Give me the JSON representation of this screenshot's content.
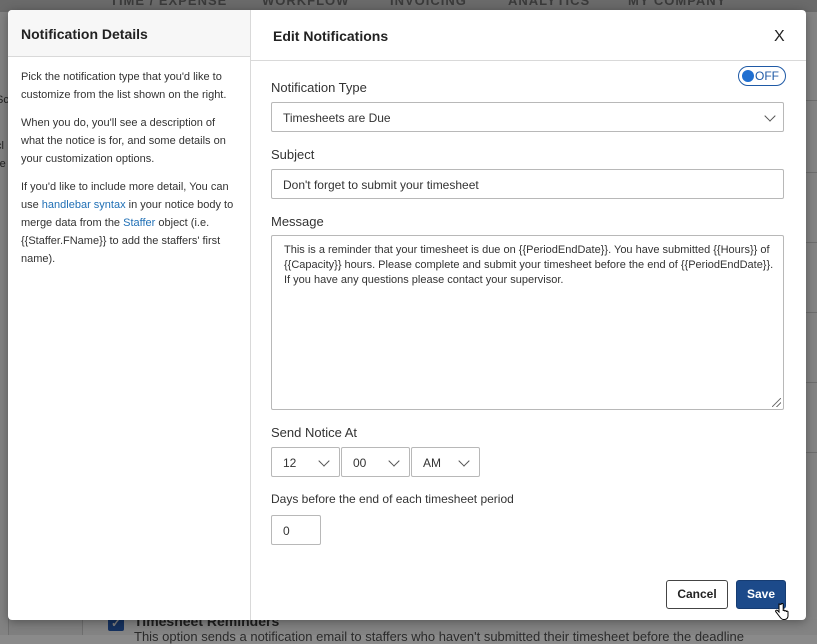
{
  "background": {
    "nav_items": [
      "TIME / EXPENSE",
      "WORKFLOW",
      "INVOICING",
      "ANALYTICS",
      "MY COMPANY"
    ],
    "left_fragments": [
      "Sc",
      "cl",
      "re"
    ],
    "bottom_section": {
      "title": "Timesheet Reminders",
      "text": "This option sends a notification email to staffers who haven't submitted their timesheet before the deadline"
    }
  },
  "sidebar": {
    "title": "Notification Details",
    "para1": "Pick the notification type that you'd like to customize from the list shown on the right.",
    "para2": "When you do, you'll see a description of what the notice is for, and some details on your customization options.",
    "para3_prefix": "If you'd like to include more detail, You can use ",
    "para3_link1": "handlebar syntax",
    "para3_mid": " in your notice body to merge data from the ",
    "para3_link2": "Staffer",
    "para3_suffix": " object (i.e. {{Staffer.FName}} to add the staffers' first name)."
  },
  "main": {
    "title": "Edit Notifications",
    "close_label": "X",
    "toggle_label": "OFF",
    "notification_type_label": "Notification Type",
    "notification_type_value": "Timesheets are Due",
    "subject_label": "Subject",
    "subject_value": "Don't forget to submit your timesheet",
    "message_label": "Message",
    "message_value": "This is a reminder that your timesheet is due on {{PeriodEndDate}}. You have submitted {{Hours}} of {{Capacity}} hours. Please complete and submit your timesheet before the end of {{PeriodEndDate}}. If you have any questions please contact your supervisor.",
    "send_notice_label": "Send Notice At",
    "hour_value": "12",
    "minute_value": "00",
    "ampm_value": "AM",
    "days_label": "Days before the end of each timesheet period",
    "days_value": "0",
    "cancel_label": "Cancel",
    "save_label": "Save"
  },
  "colors": {
    "accent": "#1f6fb5",
    "save_button": "#1c4a8a"
  }
}
